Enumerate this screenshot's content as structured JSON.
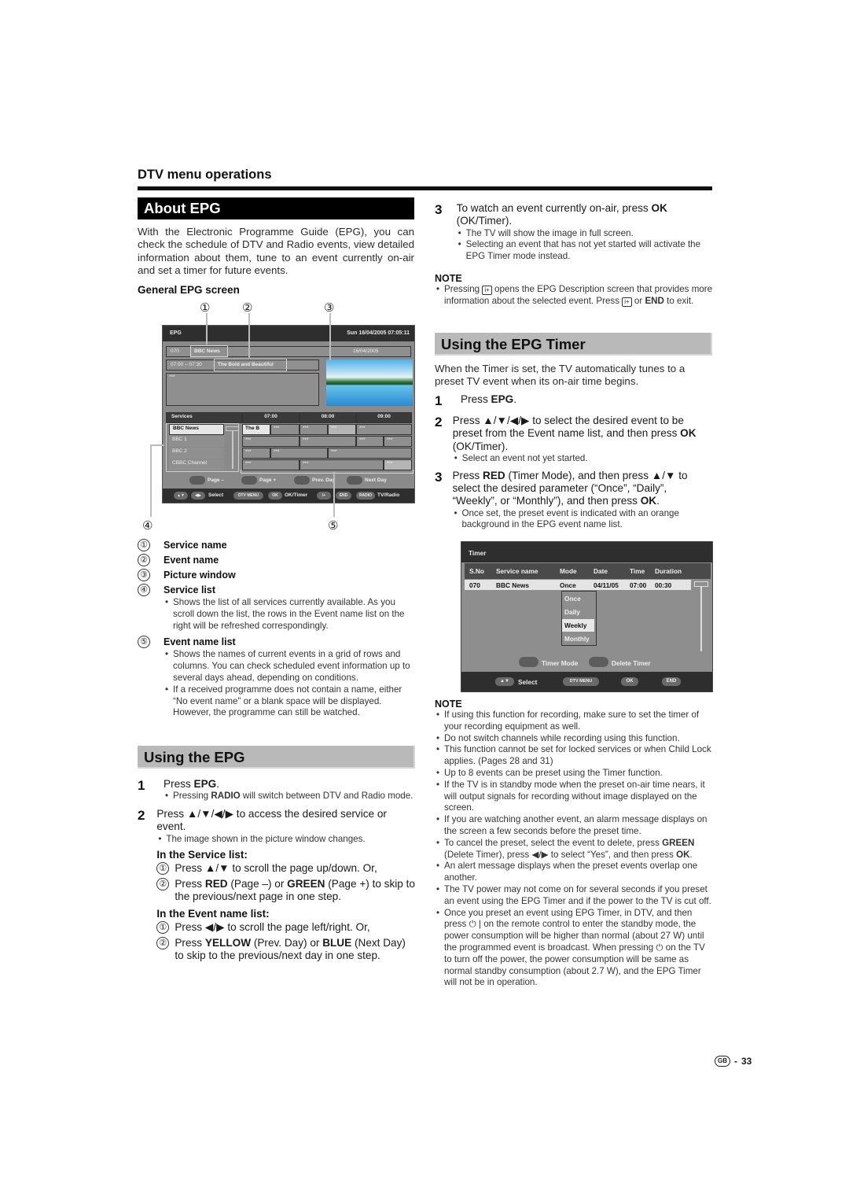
{
  "page": {
    "section_header": "DTV menu operations",
    "page_number": "33",
    "region_badge": "GB"
  },
  "about_epg": {
    "heading": "About EPG",
    "intro": "With the Electronic Programme Guide (EPG), you can check the schedule of DTV and Radio events, view detailed information about them, tune to an event currently on-air and set a timer for future events.",
    "general_screen_heading": "General EPG screen",
    "callouts": [
      "①",
      "②",
      "③",
      "④",
      "⑤"
    ],
    "items": [
      {
        "num": "①",
        "label": "Service name"
      },
      {
        "num": "②",
        "label": "Event name"
      },
      {
        "num": "③",
        "label": "Picture window"
      },
      {
        "num": "④",
        "label": "Service list",
        "bullets": [
          "Shows the list of all services currently available. As you scroll down the list, the rows in the Event name list on the right will be refreshed correspondingly."
        ]
      },
      {
        "num": "⑤",
        "label": "Event name list",
        "bullets": [
          "Shows the names of current events in a grid of rows and columns. You can check scheduled event information up to several days ahead, depending on conditions.",
          "If a received programme does not contain a name, either “No event name” or a blank space will be displayed. However, the programme can still be watched."
        ]
      }
    ]
  },
  "epg_screen": {
    "title": "EPG",
    "datetime": "Sun  16/04/2005  07:05:11",
    "channel_no": "070",
    "service_name": "BBC News",
    "date": "16/04/2005",
    "time_range": "07:00 – 07:30",
    "event_name": "The Bold and Beautiful",
    "description": "***",
    "services_header": "Services",
    "time_headers": [
      "07:00",
      "08:00",
      "09:00"
    ],
    "services": [
      "BBC News",
      "BBC 1",
      "BBC 2",
      "CBBC Channel"
    ],
    "selected_event": "The B",
    "placeholder": "***",
    "color_buttons": [
      "Page –",
      "Page +",
      "Prev. Day",
      "Next Day"
    ],
    "footer": {
      "select": "Select",
      "dtv_menu": "DTV MENU",
      "ok": "OK",
      "ok_label": "OK/Timer",
      "info": "i+",
      "end": "END",
      "radio": "RADIO",
      "radio_label": "TV/Radio"
    }
  },
  "using_epg": {
    "heading": "Using the EPG",
    "steps": [
      {
        "num": "1",
        "text_pre": "Press ",
        "text_bold": "EPG",
        "text_post": ".",
        "bullet_pre": "Pressing ",
        "bullet_bold": "RADIO",
        "bullet_post": " will switch between DTV and Radio mode."
      },
      {
        "num": "2",
        "text": "Press ▲/▼/◀/▶ to access the desired service or event.",
        "bullet": "The image shown in the picture window changes."
      }
    ],
    "service_list_heading": "In the Service list:",
    "service_list_items": [
      {
        "num": "①",
        "text": "Press ▲/▼ to scroll the page up/down. Or,"
      },
      {
        "num": "②",
        "parts": [
          "Press ",
          "RED",
          " (Page –) or ",
          "GREEN",
          " (Page +) to skip to the previous/next page in one step."
        ]
      }
    ],
    "event_list_heading": "In the Event name list:",
    "event_list_items": [
      {
        "num": "①",
        "text": "Press ◀/▶ to scroll the page left/right. Or,"
      },
      {
        "num": "②",
        "parts": [
          "Press ",
          "YELLOW",
          " (Prev. Day) or ",
          "BLUE",
          " (Next Day) to skip to the previous/next day in one step."
        ]
      }
    ]
  },
  "right_col": {
    "step3": {
      "num": "3",
      "text_pre": "To watch an event currently on-air, press ",
      "text_bold": "OK",
      "text_post": " (OK/Timer).",
      "bullets": [
        "The TV will show the image in full screen.",
        "Selecting an event that has not yet started will activate the EPG Timer mode instead."
      ]
    },
    "note1": {
      "heading": "NOTE",
      "pre": "Pressing ",
      "icon": "i+",
      "mid": " opens the EPG Description screen that provides more information about the selected event. Press ",
      "mid2": " or ",
      "bold": "END",
      "post": " to exit."
    }
  },
  "epg_timer": {
    "heading": "Using the EPG Timer",
    "intro": "When the Timer is set, the TV automatically tunes to a preset TV event when its on-air time begins.",
    "step1": {
      "num": "1",
      "pre": "Press ",
      "bold": "EPG",
      "post": "."
    },
    "step2": {
      "num": "2",
      "pre": "Press ▲/▼/◀/▶ to select the desired event to be preset from the Event name list, and then press ",
      "bold": "OK",
      "post": " (OK/Timer).",
      "bullet": "Select an event not yet started."
    },
    "step3": {
      "num": "3",
      "pre": "Press ",
      "bold1": "RED",
      "mid": " (Timer Mode), and then press ▲/▼ to select the desired parameter (“Once”, “Daily”, “Weekly”, or “Monthly”), and then press ",
      "bold2": "OK",
      "post": ".",
      "bullet": "Once set, the preset event is indicated with an orange background in the EPG event name list."
    }
  },
  "timer_screen": {
    "title": "Timer",
    "columns": [
      "S.No",
      "Service name",
      "Mode",
      "Date",
      "Time",
      "Duration"
    ],
    "row": {
      "sno": "070",
      "service": "BBC News",
      "mode": "Once",
      "date": "04/11/05",
      "time": "07:00",
      "duration": "00:30"
    },
    "mode_options": [
      "Once",
      "Daily",
      "Weekly",
      "Monthly"
    ],
    "selected_mode": "Weekly",
    "color_buttons": [
      "Timer Mode",
      "Delete Timer"
    ],
    "footer": {
      "select": "Select",
      "dtv_menu": "DTV MENU",
      "ok": "OK",
      "end": "END"
    }
  },
  "note2": {
    "heading": "NOTE",
    "bullets": [
      "If using this function for recording, make sure to set the timer of your recording equipment as well.",
      "Do not switch channels while recording using this function.",
      "This function cannot be set for locked services or when Child Lock applies. (Pages 28 and 31)",
      "Up to 8 events can be preset using the Timer function.",
      "If the TV is in standby mode when the preset on-air time nears, it will output signals for recording without image displayed on the screen.",
      "If you are watching another event, an alarm message displays on the screen a few seconds before the preset time."
    ],
    "cancel": {
      "pre": "To cancel the preset, select the event to delete, press ",
      "bold1": "GREEN",
      "mid": " (Delete Timer), press ◀/▶ to select “Yes”, and then press ",
      "bold2": "OK",
      "post": "."
    },
    "bullets_after": [
      "An alert message displays when the preset events overlap one another.",
      "The TV power may not come on for several seconds if you preset an event using the EPG Timer and if the power to the TV is cut off."
    ],
    "standby": {
      "p1": "Once you preset an event using EPG Timer, in DTV, and then press ",
      "p2": " | on the remote control to enter the standby mode, the power consumption will be higher than normal (about 27 W) until the programmed event is broadcast. When pressing ",
      "p3": " on the TV to turn off the power, the power consumption will be same as normal standby consumption (about 2.7 W), and the EPG Timer will not be in operation."
    }
  }
}
